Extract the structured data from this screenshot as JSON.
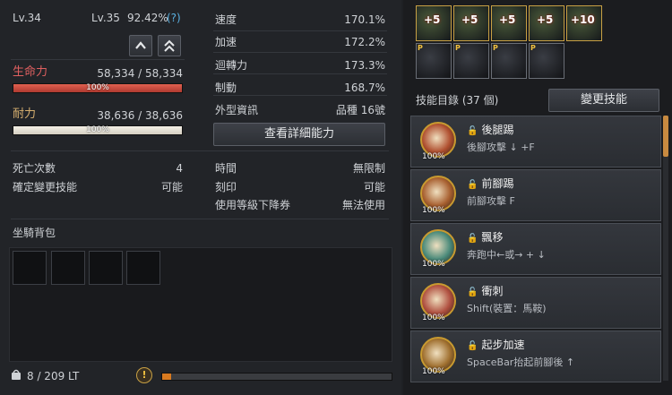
{
  "level": {
    "current": "Lv.34",
    "next": "Lv.35",
    "pct": "92.42%",
    "help": "(?)"
  },
  "hp": {
    "label": "生命力",
    "value": "58,334 / 58,334",
    "bar": "100%",
    "fill": 1.0
  },
  "stamina": {
    "label": "耐力",
    "value": "38,636 / 38,636",
    "bar": "100%",
    "fill": 1.0
  },
  "stats": [
    {
      "label": "速度",
      "value": "170.1%"
    },
    {
      "label": "加速",
      "value": "172.2%"
    },
    {
      "label": "迴轉力",
      "value": "173.3%"
    },
    {
      "label": "制動",
      "value": "168.7%"
    },
    {
      "label": "外型資訊",
      "value": "品種 16號"
    }
  ],
  "detail_button": "查看詳細能力",
  "info_left": [
    {
      "label": "死亡次數",
      "value": "4"
    },
    {
      "label": "確定變更技能",
      "value": "可能"
    }
  ],
  "info_right": [
    {
      "label": "時間",
      "value": "無限制"
    },
    {
      "label": "刻印",
      "value": "可能"
    },
    {
      "label": "使用等級下降券",
      "value": "無法使用"
    }
  ],
  "bag": {
    "title": "坐騎背包",
    "capacity": "8 / 209 LT",
    "alert_icon": "!",
    "fill": 0.04
  },
  "gear_top": [
    "+5",
    "+5",
    "+5",
    "+5",
    "+10"
  ],
  "gear_bottom": [
    "P",
    "P",
    "P",
    "P"
  ],
  "skills_header": {
    "title": "技能目錄 (37 個)",
    "button": "變更技能"
  },
  "skills": [
    {
      "name": "後腿踢",
      "desc": "後腳攻擊 ↓ +F",
      "pct": "100%",
      "color": "#b05030"
    },
    {
      "name": "前腳踢",
      "desc": "前腳攻擊 F",
      "pct": "100%",
      "color": "#a86030"
    },
    {
      "name": "飄移",
      "desc": "奔跑中←或→ + ↓",
      "pct": "100%",
      "color": "#4a8a7a"
    },
    {
      "name": "衝刺",
      "desc": "Shift(裝置：馬鞍)",
      "pct": "100%",
      "color": "#b05040"
    },
    {
      "name": "起步加速",
      "desc": "SpaceBar抬起前腳後 ↑",
      "pct": "100%",
      "color": "#a07030"
    }
  ]
}
